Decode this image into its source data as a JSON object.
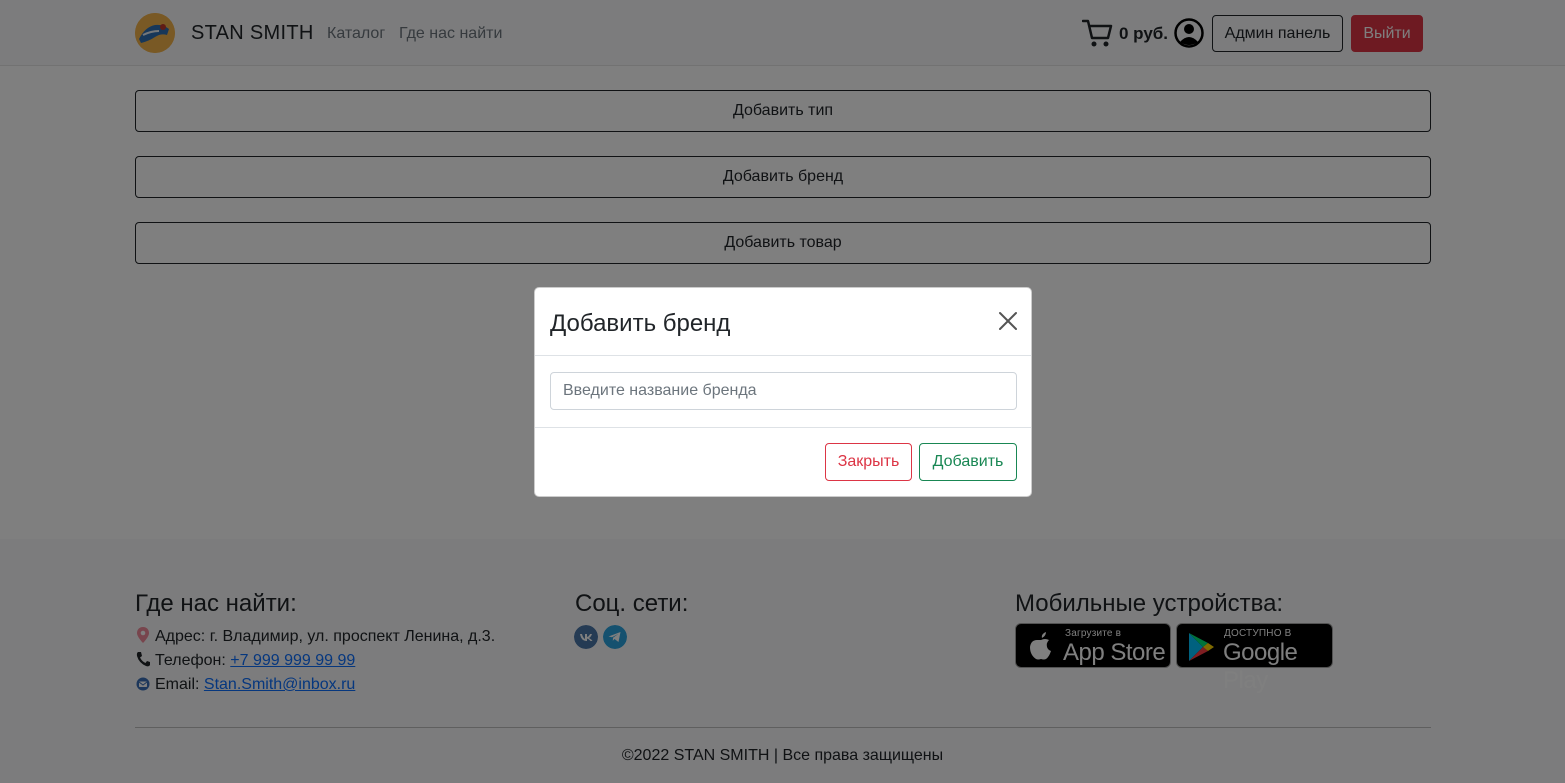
{
  "header": {
    "brand": "STAN SMITH",
    "nav": [
      "Каталог",
      "Где нас найти"
    ],
    "cart_total": "0 руб.",
    "admin_label": "Админ панель",
    "logout_label": "Выйти"
  },
  "admin": {
    "buttons": [
      "Добавить тип",
      "Добавить бренд",
      "Добавить товар"
    ]
  },
  "footer": {
    "contacts_title": "Где нас найти:",
    "address_label": "Адрес: г. Владимир, ул. проспект Ленина, д.3.",
    "phone_label": "Телефон:",
    "phone_value": "+7 999 999 99 99",
    "email_label": "Email:",
    "email_value": "Stan.Smith@inbox.ru",
    "social_title": "Соц. сети:",
    "mobile_title": "Мобильные устройства:",
    "appstore_small": "Загрузите в",
    "appstore_big": "App Store",
    "googleplay_small": "ДОСТУПНО В",
    "googleplay_big": "Google Play",
    "copyright": "©2022 STAN SMITH | Все права защищены"
  },
  "modal": {
    "title": "Добавить бренд",
    "input_placeholder": "Введите название бренда",
    "input_value": "",
    "close_label": "Закрыть",
    "add_label": "Добавить"
  },
  "colors": {
    "danger": "#dc3545",
    "success": "#198754",
    "link": "#0d6efd"
  },
  "icons": {
    "cart": "cart-icon",
    "user": "user-circle-icon",
    "close": "close-icon",
    "location": "location-pin-icon",
    "phone": "phone-icon",
    "email": "email-icon",
    "vk": "vk-icon",
    "telegram": "telegram-icon"
  }
}
